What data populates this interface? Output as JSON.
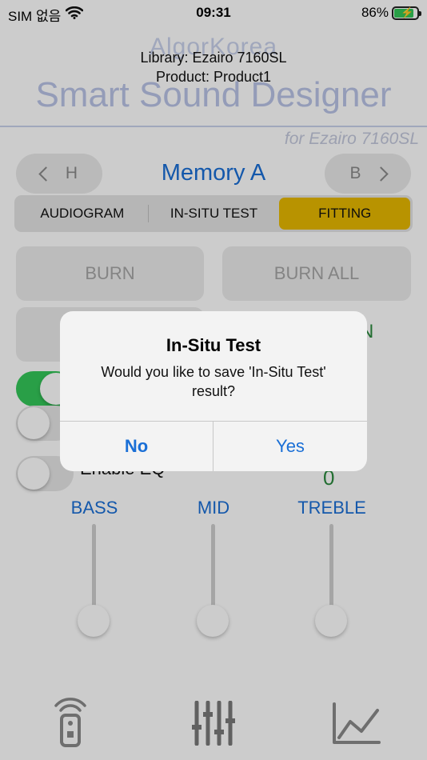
{
  "status_bar": {
    "carrier": "SIM 없음",
    "time": "09:31",
    "battery": "86%",
    "battery_level": 0.86
  },
  "header": {
    "brand_small": "AlgorKorea",
    "library": "Library: Ezairo 7160SL",
    "product": "Product: Product1",
    "brand_big": "Smart Sound Designer",
    "brand_for": "for Ezairo 7160SL"
  },
  "memory": {
    "title": "Memory A",
    "prev_label": "H",
    "next_label": "B"
  },
  "tabs": [
    {
      "label": "AUDIOGRAM",
      "active": false
    },
    {
      "label": "IN-SITU TEST",
      "active": false
    },
    {
      "label": "FITTING",
      "active": true
    }
  ],
  "accent_color": "#e6b800",
  "burn": {
    "burn_label": "BURN",
    "burn_all_label": "BURN ALL",
    "partial_green_text": "N"
  },
  "eq": {
    "enable_label": "Enable EQ",
    "value": "0"
  },
  "sliders": [
    {
      "label": "BASS"
    },
    {
      "label": "MID"
    },
    {
      "label": "TREBLE"
    }
  ],
  "tab_bar": {
    "icons": [
      "remote-icon",
      "equalizer-icon",
      "chart-icon"
    ]
  },
  "alert": {
    "title": "In-Situ Test",
    "message": "Would you like to save 'In-Situ Test' result?",
    "no_label": "No",
    "yes_label": "Yes"
  }
}
